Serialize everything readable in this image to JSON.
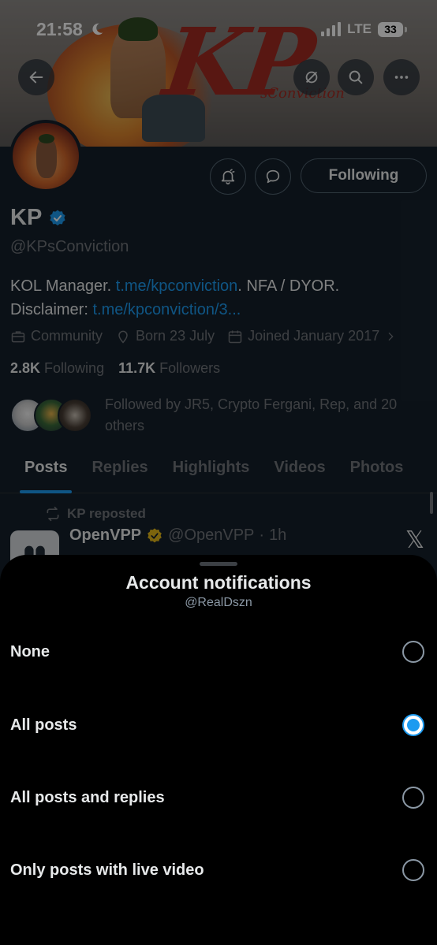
{
  "status_bar": {
    "time": "21:58",
    "network": "LTE",
    "battery": "33"
  },
  "profile": {
    "banner_logo": "KP",
    "banner_sub": "sConviction",
    "display_name": "KP",
    "handle": "@KPsConviction",
    "following_label": "Following",
    "bio": {
      "text1": "KOL Manager. ",
      "link1": "t.me/kpconviction",
      "text2": ". NFA / DYOR. Disclaimer: ",
      "link2": "t.me/kpconviction/3..."
    },
    "meta": {
      "category": "Community",
      "born": "Born 23 July",
      "joined": "Joined January 2017"
    },
    "following_count": "2.8K",
    "following_label_text": "Following",
    "followers_count": "11.7K",
    "followers_label_text": "Followers",
    "followed_by": "Followed by JR5, Crypto Fergani, Rep, and 20 others",
    "tabs": [
      "Posts",
      "Replies",
      "Highlights",
      "Videos",
      "Photos"
    ],
    "active_tab": "Posts"
  },
  "post": {
    "repost_label": "KP reposted",
    "author_name": "OpenVPP",
    "author_handle": "@OpenVPP",
    "separator": "·",
    "time": "1h"
  },
  "sheet": {
    "title": "Account notifications",
    "subtitle": "@RealDszn",
    "options": [
      {
        "label": "None",
        "selected": false
      },
      {
        "label": "All posts",
        "selected": true
      },
      {
        "label": "All posts and replies",
        "selected": false
      },
      {
        "label": "Only posts with live video",
        "selected": false
      }
    ]
  },
  "colors": {
    "accent": "#1d9bf0",
    "background": "#15202b",
    "sheet": "#000000",
    "secondary_text": "#71767b"
  },
  "icons": [
    "back-arrow-icon",
    "hide-icon",
    "search-icon",
    "more-icon",
    "notification-bell-icon",
    "message-icon",
    "verified-badge-icon",
    "briefcase-icon",
    "location-icon",
    "calendar-icon",
    "chevron-right-icon",
    "repost-icon",
    "x-logo-icon"
  ]
}
